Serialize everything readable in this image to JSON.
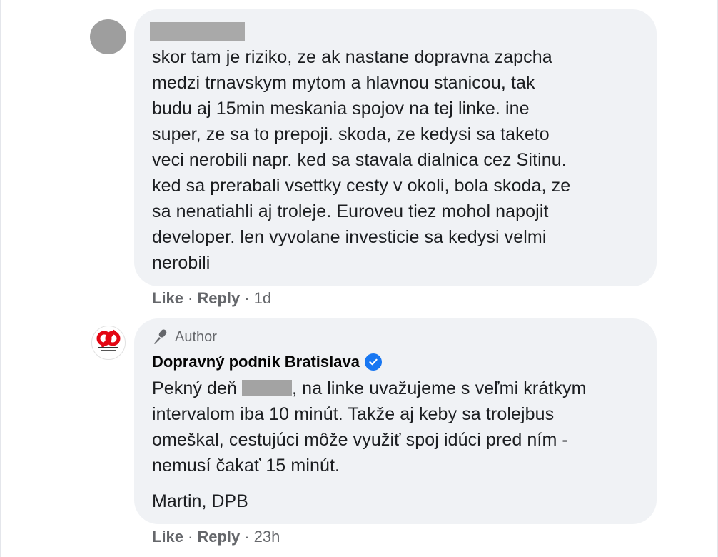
{
  "comments": [
    {
      "author_name_redacted": true,
      "text_lines": [
        "skor tam je riziko, ze ak nastane dopravna zapcha",
        "medzi trnavskym mytom a hlavnou stanicou, tak",
        "budu aj 15min meskania spojov na tej linke. ine",
        "super, ze sa to prepoji. skoda, ze kedysi sa taketo",
        "veci nerobili napr. ked sa stavala dialnica cez Sitinu.",
        "ked sa prerabali vsettky cesty v okoli, bola skoda, ze",
        "sa nenatiahli aj troleje. Euroveu tiez mohol napojit",
        "developer. len vyvolane investicie sa kedysi velmi",
        "nerobili"
      ],
      "like_label": "Like",
      "reply_label": "Reply",
      "time": "1d"
    },
    {
      "badge_label": "Author",
      "badge_icon": "microphone-icon",
      "author_name": "Dopravný podnik Bratislava",
      "verified": true,
      "verified_color": "#1877f2",
      "text_line1_before": "Pekný deň ",
      "text_line1_after": ", na linke uvažujeme s veľmi krátkym",
      "text_lines": [
        "intervalom iba 10 minút. Takže aj keby sa trolejbus",
        "omeškal, cestujúci môže využiť spoj idúci pred ním -",
        "nemusí čakať 15 minút."
      ],
      "signature": "Martin, DPB",
      "like_label": "Like",
      "reply_label": "Reply",
      "time": "23h"
    }
  ],
  "colors": {
    "bubble": "#f0f2f5",
    "secondary_text": "#65676b",
    "brand_red": "#e30613"
  }
}
